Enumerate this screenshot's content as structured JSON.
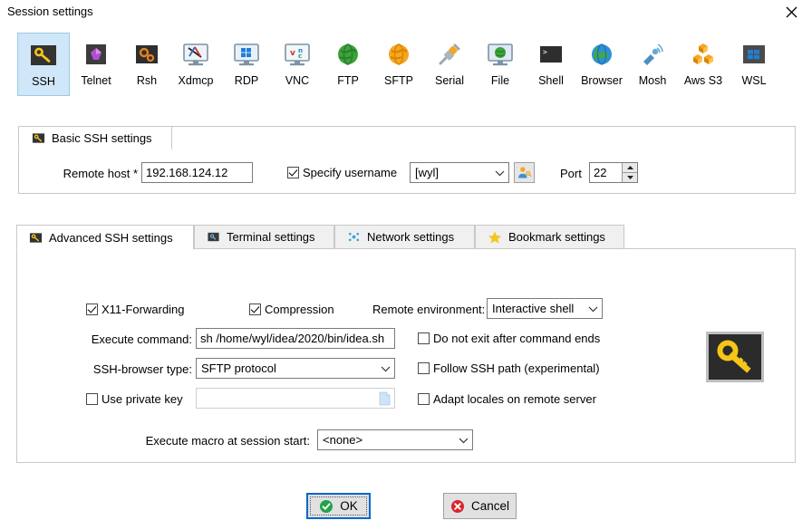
{
  "window": {
    "title": "Session settings",
    "close_icon": "close-icon"
  },
  "session_types": [
    {
      "label": "SSH",
      "icon": "ssh-key-icon",
      "selected": true
    },
    {
      "label": "Telnet",
      "icon": "telnet-gem-icon",
      "selected": false
    },
    {
      "label": "Rsh",
      "icon": "rsh-gears-icon",
      "selected": false
    },
    {
      "label": "Xdmcp",
      "icon": "xdmcp-monitor-icon",
      "selected": false
    },
    {
      "label": "RDP",
      "icon": "rdp-windows-icon",
      "selected": false
    },
    {
      "label": "VNC",
      "icon": "vnc-monitor-icon",
      "selected": false
    },
    {
      "label": "FTP",
      "icon": "ftp-globe-icon",
      "selected": false
    },
    {
      "label": "SFTP",
      "icon": "sftp-globe-icon",
      "selected": false
    },
    {
      "label": "Serial",
      "icon": "serial-plug-icon",
      "selected": false
    },
    {
      "label": "File",
      "icon": "file-monitor-icon",
      "selected": false
    },
    {
      "label": "Shell",
      "icon": "shell-terminal-icon",
      "selected": false
    },
    {
      "label": "Browser",
      "icon": "browser-globe-icon",
      "selected": false
    },
    {
      "label": "Mosh",
      "icon": "mosh-satellite-icon",
      "selected": false
    },
    {
      "label": "Aws S3",
      "icon": "aws-s3-cubes-icon",
      "selected": false
    },
    {
      "label": "WSL",
      "icon": "wsl-windows-icon",
      "selected": false
    }
  ],
  "basic": {
    "tab_label": "Basic SSH settings",
    "tab_icon": "ssh-key-icon",
    "remote_host_label": "Remote host *",
    "remote_host_value": "192.168.124.12",
    "specify_username_label": "Specify username",
    "specify_username_checked": true,
    "username_value": "[wyl]",
    "user_button_icon": "user-key-icon",
    "port_label": "Port",
    "port_value": "22"
  },
  "adv_tabs": [
    {
      "label": "Advanced SSH settings",
      "icon": "ssh-key-icon",
      "active": true
    },
    {
      "label": "Terminal settings",
      "icon": "terminal-icon",
      "active": false
    },
    {
      "label": "Network settings",
      "icon": "network-dots-icon",
      "active": false
    },
    {
      "label": "Bookmark settings",
      "icon": "star-icon",
      "active": false
    }
  ],
  "advanced": {
    "x11_label": "X11-Forwarding",
    "x11_checked": true,
    "compression_label": "Compression",
    "compression_checked": true,
    "remote_env_label": "Remote environment:",
    "remote_env_value": "Interactive shell",
    "execute_command_label": "Execute command:",
    "execute_command_value": "sh /home/wyl/idea/2020/bin/idea.sh",
    "do_not_exit_label": "Do not exit after command ends",
    "do_not_exit_checked": false,
    "browser_type_label": "SSH-browser type:",
    "browser_type_value": "SFTP protocol",
    "follow_path_label": "Follow SSH path (experimental)",
    "follow_path_checked": false,
    "use_private_key_label": "Use private key",
    "use_private_key_checked": false,
    "private_key_value": "",
    "private_key_browse_icon": "file-browse-icon",
    "adapt_locales_label": "Adapt locales on remote server",
    "adapt_locales_checked": false,
    "macro_label": "Execute macro at session start:",
    "macro_value": "<none>",
    "side_icon": "large-key-icon"
  },
  "footer": {
    "ok_label": "OK",
    "ok_icon": "check-circle-icon",
    "cancel_label": "Cancel",
    "cancel_icon": "x-circle-icon"
  },
  "colors": {
    "selection": "#cfe7f8",
    "focus": "#0066cc",
    "key_yellow": "#f5c518",
    "ok_green": "#22a24a",
    "cancel_red": "#d7262a"
  }
}
